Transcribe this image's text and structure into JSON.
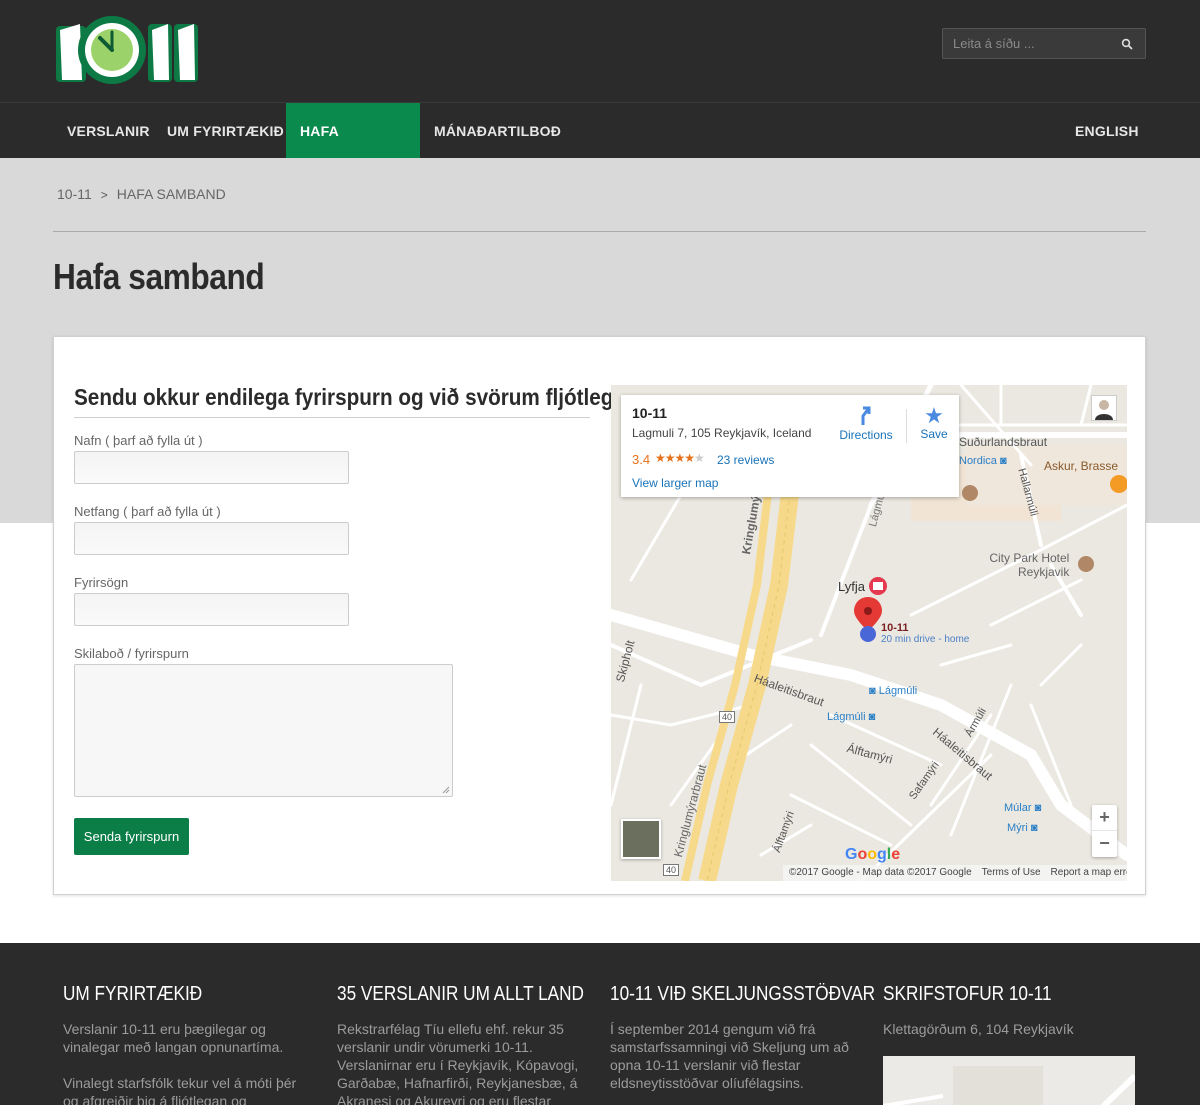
{
  "header": {
    "logo_text": "10-11",
    "search_placeholder": "Leita á síðu ..."
  },
  "nav": {
    "items": [
      "VERSLANIR",
      "UM FYRIRTÆKIÐ",
      "HAFA SAMBAND",
      "MÁNAÐARTILBOÐ"
    ],
    "active": "HAFA SAMBAND",
    "language": "ENGLISH"
  },
  "breadcrumb": {
    "home": "10-11",
    "separator": ">",
    "current": "HAFA SAMBAND"
  },
  "page": {
    "title": "Hafa samband"
  },
  "form": {
    "heading": "Sendu okkur endilega fyrirspurn og við svörum fljótlega",
    "name_label": "Nafn ( þarf að fylla út )",
    "email_label": "Netfang ( þarf að fylla út )",
    "subject_label": "Fyrirsögn",
    "message_label": "Skilaboð / fyrirspurn",
    "submit_label": "Senda fyrirspurn"
  },
  "map": {
    "place_name": "10-11",
    "address": "Lagmuli 7, 105 Reykjavík, Iceland",
    "rating": "3.4",
    "stars": "★★★★",
    "stars_off": "★",
    "reviews": "23 reviews",
    "view_larger": "View larger map",
    "directions": "Directions",
    "save": "Save",
    "zoom_in": "+",
    "zoom_out": "−",
    "marker_label": "10-11",
    "marker_sub": "20 min drive - home",
    "google_logo": "Google",
    "copyright": "©2017 Google - Map data ©2017 Google",
    "terms": "Terms of Use",
    "report": "Report a map error",
    "labels": {
      "kringlu_top": "Kringlumýrarb",
      "kringlu_bottom": "Kringlumýrarbraut",
      "skipholt": "Skipholt",
      "haaleitis1": "Háaleitisbraut",
      "haaleitis2": "Háaleitisbraut",
      "lagmuli_road": "Lágmúli",
      "lagmuli_stop1": "Lágmúli",
      "lagmuli_stop2": "Lágmúli",
      "alftamyri1": "Álftamýri",
      "alftamyri2": "Álftamýri",
      "safamyri": "Safamýri",
      "armuli": "Ármúli",
      "hallarmuli": "Hallarmúli",
      "sudurlands": "Suðurlandsbraut",
      "nordica": "Nordica",
      "askur": "Askur, Brasse",
      "citypark1": "City Park Hotel",
      "citypark2": "Reykjavik",
      "lyfja": "Lyfja",
      "mular": "Múlar",
      "myri": "Mýri",
      "route40a": "40",
      "route40b": "40"
    }
  },
  "footer": {
    "col1": {
      "title": "UM FYRIRTÆKIÐ",
      "p1": "Verslanir 10-11 eru þægilegar og vinalegar með langan opnunartíma.",
      "p2": "Vinalegt starfsfólk tekur vel á móti þér og afgreiðir þig á fljótlegan og þægilegan"
    },
    "col2": {
      "title": "35 VERSLANIR UM ALLT LAND",
      "p1": "Rekstrarfélag Tíu ellefu ehf. rekur 35 verslanir undir vörumerki 10-11. Verslanirnar eru í Reykjavík, Kópavogi, Garðabæ, Hafnarfirði, Reykjanesbæ, á Akranesi og Akureyri og eru flestar þeirra"
    },
    "col3": {
      "title": "10-11 VIÐ SKELJUNGSSTÖÐVAR",
      "p1": "Í september 2014 gengum við frá samstarfssamningi við Skeljung um að opna 10-11 verslanir við flestar eldsneytisstöðvar olíufélagsins."
    },
    "col4": {
      "title": "SKRIFSTOFUR 10-11",
      "p1": "Klettagörðum 6, 104 Reykjavík"
    }
  },
  "colors": {
    "brand_green": "#0b8a4d",
    "dark_bg": "#2b2b2b",
    "band_gray": "#d9d9d9",
    "link_blue": "#1a73b8"
  }
}
